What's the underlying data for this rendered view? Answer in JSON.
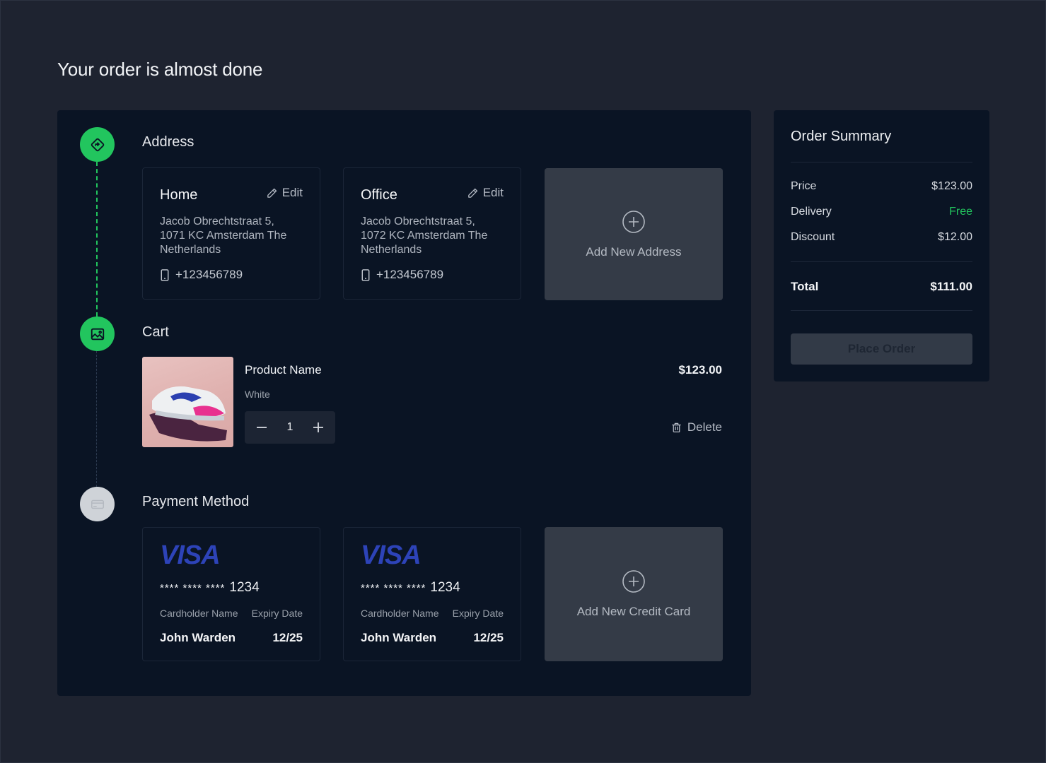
{
  "page": {
    "title": "Your order is almost done"
  },
  "steps": {
    "address": {
      "title": "Address",
      "icon": "directions-icon",
      "state": "active"
    },
    "cart": {
      "title": "Cart",
      "icon": "image-icon",
      "state": "active"
    },
    "payment": {
      "title": "Payment Method",
      "icon": "credit-card-icon",
      "state": "inactive"
    }
  },
  "addresses": [
    {
      "name": "Home",
      "edit_label": "Edit",
      "street": "Jacob Obrechtstraat 5,",
      "city": "1071 KC Amsterdam The Netherlands",
      "phone": "+123456789"
    },
    {
      "name": "Office",
      "edit_label": "Edit",
      "street": "Jacob Obrechtstraat 5,",
      "city": "1072 KC Amsterdam The Netherlands",
      "phone": "+123456789"
    }
  ],
  "add_address": {
    "label": "Add New Address"
  },
  "cart": {
    "item": {
      "name": "Product Name",
      "color": "White",
      "price": "$123.00",
      "quantity": "1",
      "delete_label": "Delete"
    }
  },
  "payment_cards": [
    {
      "brand": "VISA",
      "mask": "**** **** ****",
      "last4": "1234",
      "holder_label": "Cardholder Name",
      "expiry_label": "Expiry Date",
      "holder": "John Warden",
      "expiry": "12/25"
    },
    {
      "brand": "VISA",
      "mask": "**** **** ****",
      "last4": "1234",
      "holder_label": "Cardholder Name",
      "expiry_label": "Expiry Date",
      "holder": "John Warden",
      "expiry": "12/25"
    }
  ],
  "add_card": {
    "label": "Add New Credit Card"
  },
  "summary": {
    "title": "Order Summary",
    "price_label": "Price",
    "price": "$123.00",
    "delivery_label": "Delivery",
    "delivery": "Free",
    "discount_label": "Discount",
    "discount": "$12.00",
    "total_label": "Total",
    "total": "$111.00",
    "place_order_label": "Place Order"
  },
  "colors": {
    "accent": "#22c55e",
    "panel": "#0a1424",
    "background": "#1e2330",
    "visa": "#2d43b8"
  }
}
